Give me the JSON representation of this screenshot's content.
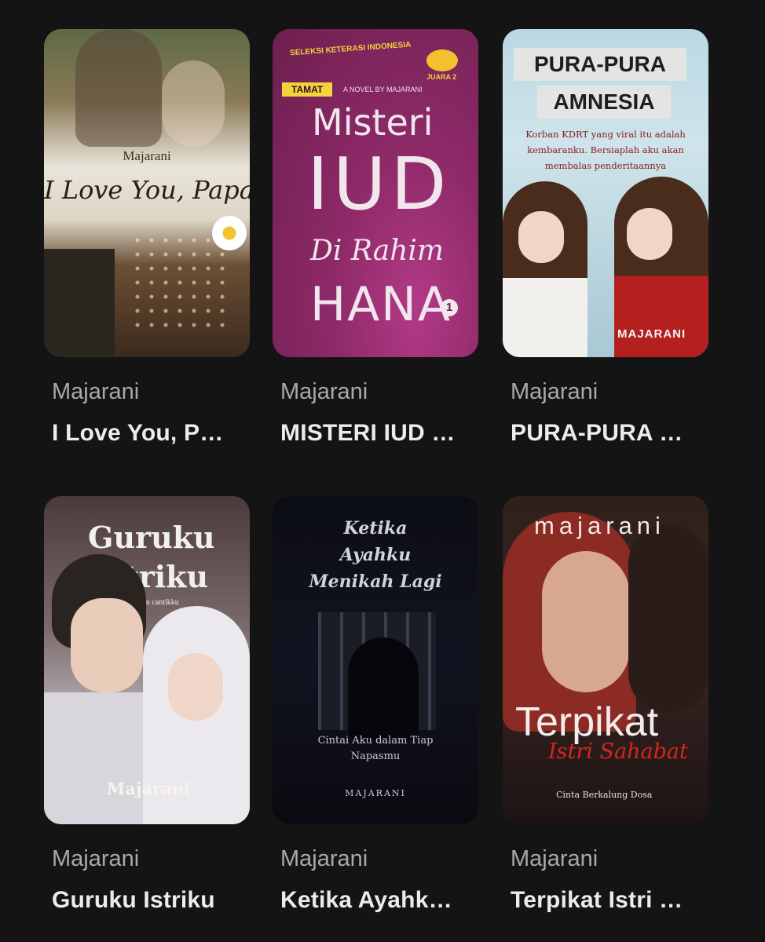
{
  "books": [
    {
      "author": "Majarani",
      "title": "I Love You, P…",
      "cover": {
        "author": "Majarani",
        "title": "I Love You, Papa"
      }
    },
    {
      "author": "Majarani",
      "title": "MISTERI IUD …",
      "cover": {
        "badge_top": "SELEKSI KETERASI INDONESIA",
        "badge_rank": "JUARA 2",
        "status": "TAMAT",
        "byline": "A NOVEL BY MAJARANI",
        "line1": "Misteri",
        "line2": "IUD",
        "line3": "Di Rahim",
        "line4": "HANA",
        "volume": "1"
      }
    },
    {
      "author": "Majarani",
      "title": "PURA-PURA …",
      "cover": {
        "line1": "PURA-PURA",
        "line2": "AMNESIA",
        "tagline": "Korban KDRT yang viral itu adalah kembaranku. Bersiaplah aku akan membalas penderitaannya",
        "author": "MAJARANI"
      }
    },
    {
      "author": "Majarani",
      "title": "Guruku Istriku",
      "cover": {
        "line1": "Guruku",
        "line2": "Istriku",
        "subtitle": "Menjebak guru cantikku",
        "author": "Majarani"
      }
    },
    {
      "author": "Majarani",
      "title": "Ketika Ayahk…",
      "cover": {
        "line1": "Ketika",
        "line2": "Ayahku",
        "line3": "Menikah Lagi",
        "subtitle1": "Cintai Aku dalam Tiap",
        "subtitle2": "Napasmu",
        "author": "MAJARANI"
      }
    },
    {
      "author": "Majarani",
      "title": "Terpikat Istri …",
      "cover": {
        "author": "majarani",
        "line1": "Terpikat",
        "line2": "Istri Sahabat",
        "tagline": "Cinta Berkalung Dosa"
      }
    }
  ],
  "colors": {
    "background": "#141414",
    "author_text": "#a9a9a9",
    "title_text": "#ececec"
  }
}
